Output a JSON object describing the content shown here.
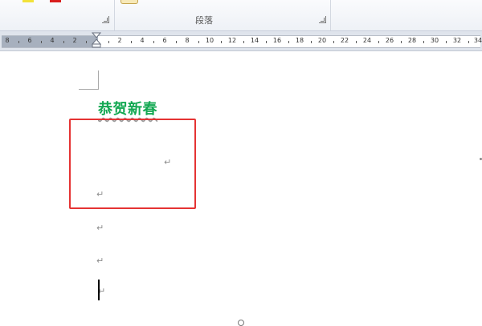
{
  "ribbon": {
    "paragraph_group_label": "段落",
    "swatch_colors": {
      "yellow": "#f2e23a",
      "red": "#d81e1e"
    }
  },
  "ruler": {
    "left_numbers": [
      "8",
      "6",
      "4",
      "2"
    ],
    "right_numbers": [
      "2",
      "4",
      "6",
      "8",
      "10",
      "12",
      "14",
      "16",
      "18",
      "20",
      "22",
      "24",
      "26",
      "28",
      "30",
      "32",
      "34"
    ]
  },
  "document": {
    "heading_text": "恭贺新春",
    "heading_color": "#13a852",
    "paragraph_mark": "↵",
    "highlight_color": "#e53333"
  }
}
